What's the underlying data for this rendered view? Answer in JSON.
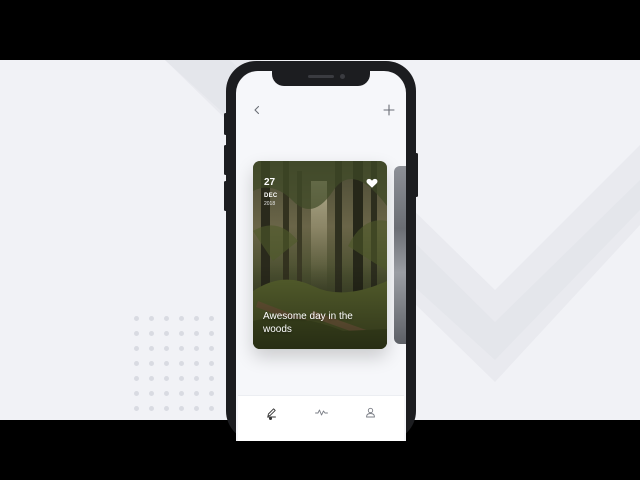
{
  "header": {
    "back_icon": "chevron-left-icon",
    "add_icon": "plus-icon"
  },
  "card": {
    "day": "27",
    "month": "DEC",
    "year": "2018",
    "title": "Awesome day in the woods",
    "favorite_icon": "heart-icon",
    "favorited": true
  },
  "tabbar": {
    "items": [
      {
        "icon": "pen-icon",
        "active": true
      },
      {
        "icon": "activity-wave-icon",
        "active": false
      },
      {
        "icon": "profile-icon",
        "active": false
      }
    ]
  },
  "colors": {
    "background": "#f1f2f6",
    "phone_frame": "#1c1d20",
    "screen": "#f6f7fa",
    "card_text": "#ffffff"
  }
}
